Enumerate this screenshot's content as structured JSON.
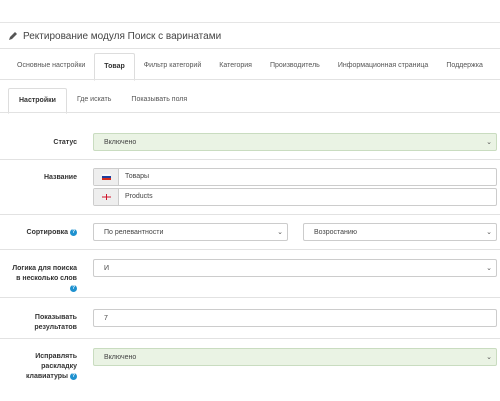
{
  "panel": {
    "title": "Ректирование модуля Поиск с варинатами",
    "title_icon": "pencil-icon"
  },
  "main_tabs": [
    {
      "label": "Основные настройки",
      "active": false
    },
    {
      "label": "Товар",
      "active": true
    },
    {
      "label": "Фильтр категорий",
      "active": false
    },
    {
      "label": "Категория",
      "active": false
    },
    {
      "label": "Производитель",
      "active": false
    },
    {
      "label": "Информационная страница",
      "active": false
    },
    {
      "label": "Поддержка",
      "active": false
    }
  ],
  "sub_tabs": [
    {
      "label": "Настройки",
      "active": true
    },
    {
      "label": "Где искать",
      "active": false
    },
    {
      "label": "Показывать поля",
      "active": false
    }
  ],
  "form": {
    "status": {
      "label": "Статус",
      "value": "Включено"
    },
    "name": {
      "label": "Название",
      "ru": {
        "value": "Товары",
        "flag": "russia-flag-icon"
      },
      "en": {
        "value": "Products",
        "flag": "uk-flag-icon"
      }
    },
    "sort": {
      "label": "Сортировка",
      "value": "По релевантности",
      "order": "Возростанию"
    },
    "logic": {
      "label_line1": "Логика для поиска",
      "label_line2": "в несколько слов",
      "value": "И"
    },
    "results": {
      "label_line1": "Показывать",
      "label_line2": "результатов",
      "value": "7"
    },
    "layout": {
      "label_line1": "Исправлять",
      "label_line2": "раскладку",
      "label_line3": "клавиатуры",
      "value": "Включено"
    }
  },
  "colors": {
    "help": "#1e91cf",
    "enabled_bg": "#eaf3e4"
  }
}
